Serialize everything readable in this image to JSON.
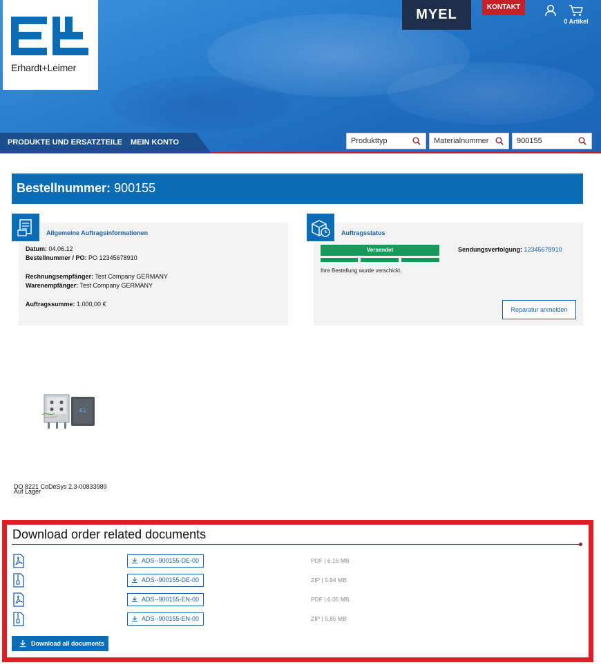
{
  "header": {
    "brand_name": "Erhardt+Leimer",
    "myel_label": "MYEL",
    "contact_label": "KONTAKT",
    "cart_count_label": "0 Artikel",
    "nav": [
      {
        "label": "PRODUKTE UND ERSATZTEILE"
      },
      {
        "label": "MEIN KONTO"
      }
    ],
    "search": {
      "product_type_placeholder": "Produkttyp",
      "material_number_placeholder": "Materialnummer",
      "query_value": "900155"
    },
    "colors": {
      "accent": "#0b6cb6",
      "brand_red": "#c8202a",
      "nav_dark": "#1a4e8c"
    }
  },
  "order": {
    "title_label": "Bestellnummer:",
    "title_value": "900155",
    "general_info": {
      "heading": "Allgemeine Auftragsinformationen",
      "date_label": "Datum:",
      "date_value": "04.06.12",
      "po_label": "Bestellnummer / PO:",
      "po_value": "PO 12345678910",
      "invoice_label": "Rechnungsempfänger:",
      "invoice_value": "Test Company GERMANY",
      "recipient_label": "Warenempfänger:",
      "recipient_value": "Test Company GERMANY",
      "total_label": "Auftragssumme:",
      "total_value": "1.000,00 €"
    },
    "status": {
      "heading": "Auftragsstatus",
      "status_label": "Versendet",
      "status_message": "Ihre Bestellung wurde verschickt.",
      "tracking_label": "Sendungsverfolgung:",
      "tracking_number": "12345678910",
      "repair_button": "Reparatur anmelden",
      "status_color": "#149a5a"
    }
  },
  "product": {
    "name": "DO 8221 CoDeSys 2.3-00833989",
    "stock": "Auf Lager"
  },
  "downloads": {
    "title": "Download order related documents",
    "items": [
      {
        "icon": "pdf-file-icon",
        "label": "ADS--900155-DE-00",
        "meta": "PDF | 6.16 MB"
      },
      {
        "icon": "zip-file-icon",
        "label": "ADS--900155-DE-00",
        "meta": "ZIP | 5.94 MB"
      },
      {
        "icon": "pdf-file-icon",
        "label": "ADS--900155-EN-00",
        "meta": "PDF | 6.05 MB"
      },
      {
        "icon": "zip-file-icon",
        "label": "ADS--900155-EN-00",
        "meta": "ZIP | 5.85 MB"
      }
    ],
    "download_all_label": "Download all documents",
    "frame_color": "#e21c25"
  }
}
